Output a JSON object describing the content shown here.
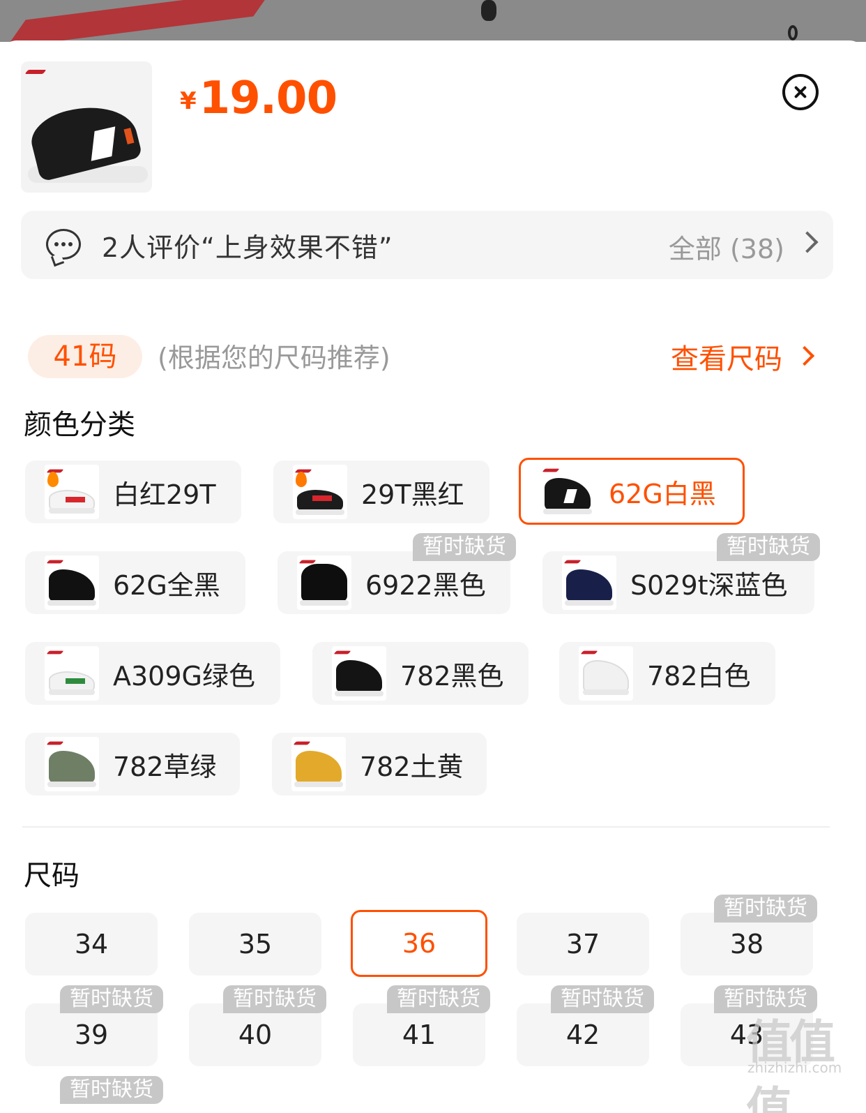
{
  "product": {
    "currency": "¥",
    "price": "19.00"
  },
  "review": {
    "summary": "2人评价“上身效果不错”",
    "all_label": "全部 (38)"
  },
  "size_recommend": {
    "pill": "41码",
    "note": "(根据您的尺码推荐)",
    "link": "查看尺码"
  },
  "colors": {
    "title": "颜色分类",
    "items": [
      {
        "label": "白红29T",
        "selected": false
      },
      {
        "label": "29T黑红",
        "selected": false
      },
      {
        "label": "62G白黑",
        "selected": true
      },
      {
        "label": "62G全黑",
        "selected": false
      },
      {
        "label": "6922黑色",
        "selected": false,
        "badge": "暂时缺货"
      },
      {
        "label": "S029t深蓝色",
        "selected": false,
        "badge": "暂时缺货"
      },
      {
        "label": "A309G绿色",
        "selected": false
      },
      {
        "label": "782黑色",
        "selected": false
      },
      {
        "label": "782白色",
        "selected": false
      },
      {
        "label": "782草绿",
        "selected": false
      },
      {
        "label": "782土黄",
        "selected": false
      }
    ]
  },
  "sizes": {
    "title": "尺码",
    "items": [
      {
        "label": "34"
      },
      {
        "label": "35"
      },
      {
        "label": "36",
        "selected": true
      },
      {
        "label": "37"
      },
      {
        "label": "38",
        "badge": "暂时缺货"
      },
      {
        "label": "39",
        "badge": "暂时缺货"
      },
      {
        "label": "40",
        "badge": "暂时缺货"
      },
      {
        "label": "41",
        "badge": "暂时缺货"
      },
      {
        "label": "42",
        "badge": "暂时缺货"
      },
      {
        "label": "43",
        "badge": "暂时缺货"
      }
    ],
    "last_badge": "暂时缺货"
  },
  "watermark": {
    "text": "值值值",
    "url": "zhizhizhi.com"
  },
  "colors_palette": {
    "accent": "#ff5000",
    "badge": "#c7c7c7",
    "option_bg": "#f5f5f5"
  }
}
